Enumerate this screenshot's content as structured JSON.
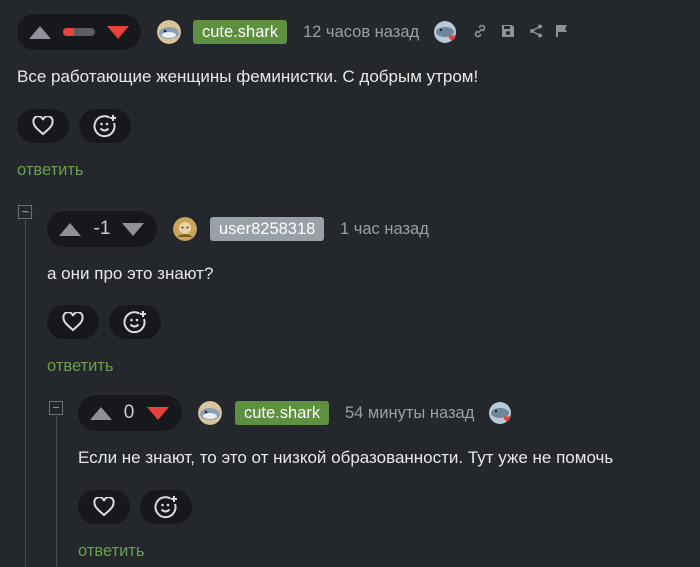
{
  "comments": [
    {
      "rating": {
        "value": "",
        "indicator": "mixed"
      },
      "author": "cute.shark",
      "time": "12 часов назад",
      "text": "Все работающие женщины феминистки. С добрым утром!",
      "reply_label": "ответить"
    },
    {
      "rating": {
        "value": "-1"
      },
      "author": "user8258318",
      "time": "1 час назад",
      "text": "а они про это знают?",
      "reply_label": "ответить"
    },
    {
      "rating": {
        "value": "0"
      },
      "author": "cute.shark",
      "time": "54 минуты назад",
      "text": "Если не знают, то это от низкой образованности. Тут уже не помочь",
      "reply_label": "ответить"
    }
  ],
  "colors": {
    "accent_green": "#5d913f",
    "reply_green": "#67a24a",
    "downvote_red": "#e8413c",
    "background": "#24272b"
  },
  "icons": [
    "link-icon",
    "save-icon",
    "share-icon",
    "flag-icon",
    "heart-icon",
    "emoji-add-icon",
    "shark-avatar-icon",
    "shark-heart-badge-icon"
  ]
}
